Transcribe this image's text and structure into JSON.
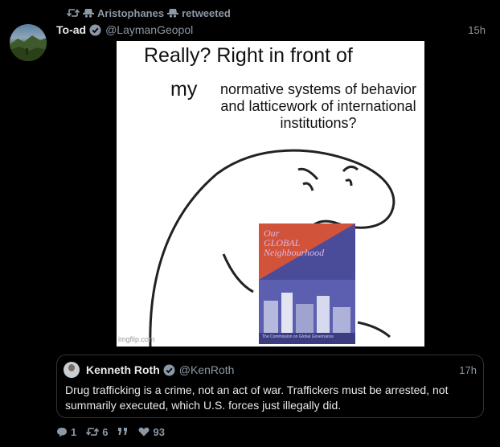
{
  "retweet": {
    "retweeter": "Aristophanes",
    "suffix": "retweeted"
  },
  "tweet": {
    "display_name": "To-ad",
    "handle": "@LaymanGeopol",
    "time": "15h",
    "image": {
      "text_top": "Really? Right in front of",
      "text_my": "my",
      "text_caption": "normative systems of behavior and latticework of international institutions?",
      "watermark": "imgflip.com",
      "book_title_line1": "Our",
      "book_title_line2": "GLOBAL",
      "book_title_line3": "Neighbourhood",
      "book_footer": "The Commission on Global Governance"
    }
  },
  "quoted_tweet": {
    "display_name": "Kenneth Roth",
    "handle": "@KenRoth",
    "time": "17h",
    "text": "Drug trafficking is a crime, not an act of war. Traffickers must be arrested, not summarily executed, which U.S. forces just illegally did."
  },
  "actions": {
    "replies": "1",
    "retweets": "6",
    "likes": "93"
  },
  "colors": {
    "background": "#000000",
    "muted": "#8b98a5",
    "verified": "#8b98a5"
  }
}
